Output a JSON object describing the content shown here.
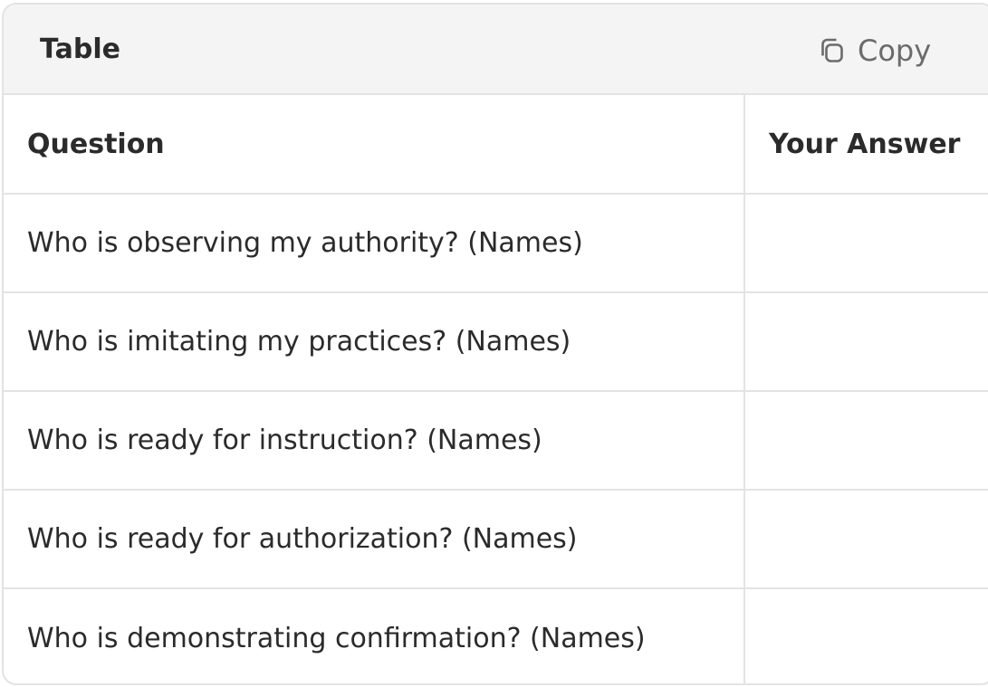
{
  "header": {
    "title": "Table",
    "copy_label": "Copy",
    "copy_icon": "copy-icon"
  },
  "table": {
    "columns": [
      "Question",
      "Your Answer"
    ],
    "rows": [
      {
        "question": "Who is observing my authority? (Names)",
        "answer": ""
      },
      {
        "question": "Who is imitating my practices? (Names)",
        "answer": ""
      },
      {
        "question": "Who is ready for instruction? (Names)",
        "answer": ""
      },
      {
        "question": "Who is ready for authorization? (Names)",
        "answer": ""
      },
      {
        "question": "Who is demonstrating confirmation? (Names)",
        "answer": ""
      }
    ]
  },
  "colors": {
    "header_bg": "#f4f4f4",
    "border": "#e3e3e3",
    "text": "#2b2b2b",
    "muted": "#6b6b6b"
  }
}
